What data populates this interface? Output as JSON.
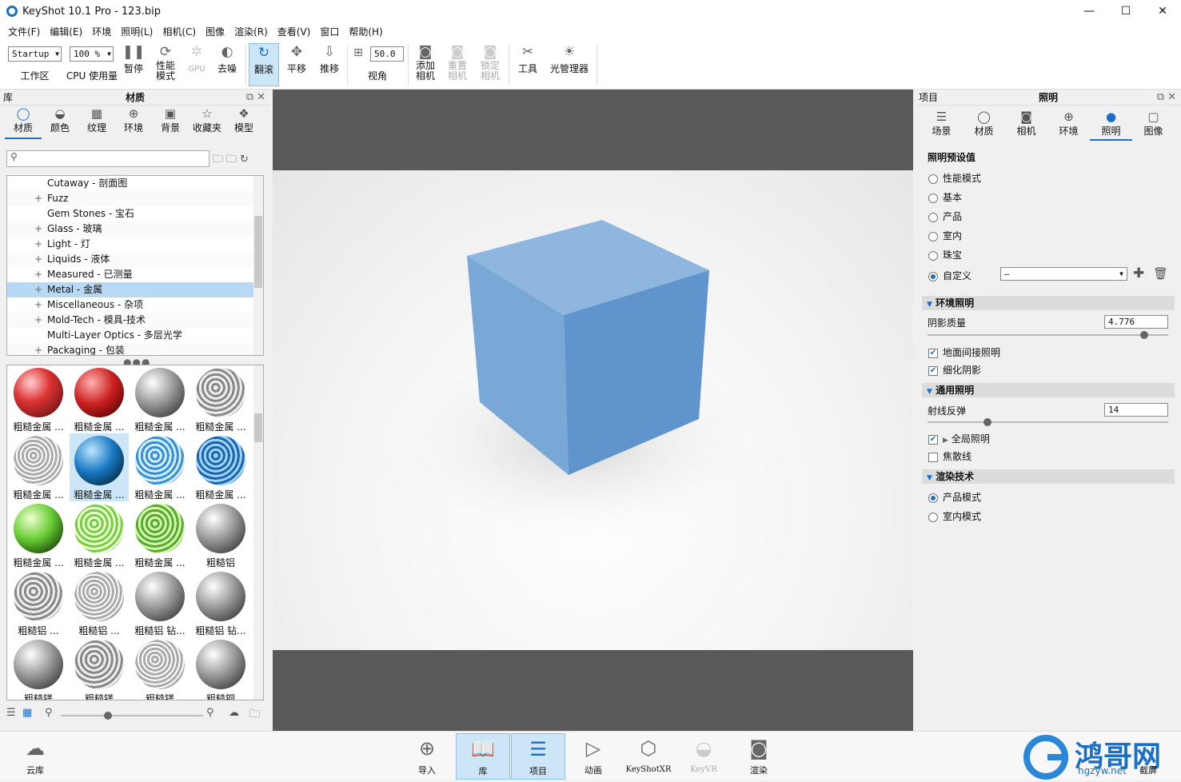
{
  "window": {
    "title": "KeyShot 10.1 Pro  - 123.bip",
    "min": "—",
    "max": "☐",
    "close": "✕"
  },
  "menu": [
    "文件(F)",
    "编辑(E)",
    "环境",
    "照明(L)",
    "相机(C)",
    "图像",
    "渲染(R)",
    "查看(V)",
    "窗口",
    "帮助(H)"
  ],
  "toolbar": {
    "workspace_value": "Startup",
    "workspace_label": "工作区",
    "cpu_value": "100 %",
    "cpu_label": "CPU 使用量",
    "pause": "暂停",
    "perf_mode": "性能\n模式",
    "gpu": "GPU",
    "denoise": "去噪",
    "tumble": "翻滚",
    "pan": "平移",
    "dolly": "推移",
    "fov_value": "50.0",
    "fov_label": "视角",
    "add_camera": "添加\n相机",
    "reset_camera": "重置\n相机",
    "lock_camera": "锁定\n相机",
    "tools": "工具",
    "light_manager": "光管理器"
  },
  "library": {
    "panel_left": "库",
    "panel_title": "材质",
    "tabs": [
      "材质",
      "颜色",
      "纹理",
      "环境",
      "背景",
      "收藏夹",
      "模型"
    ],
    "search_placeholder": "⚲",
    "tree": [
      {
        "label": "Cutaway - 剖面图",
        "pm": ""
      },
      {
        "label": "Fuzz",
        "pm": "+"
      },
      {
        "label": "Gem Stones - 宝石",
        "pm": ""
      },
      {
        "label": "Glass - 玻璃",
        "pm": "+"
      },
      {
        "label": "Light - 灯",
        "pm": "+"
      },
      {
        "label": "Liquids - 液体",
        "pm": "+"
      },
      {
        "label": "Measured - 已测量",
        "pm": "+"
      },
      {
        "label": "Metal - 金属",
        "pm": "+"
      },
      {
        "label": "Miscellaneous - 杂项",
        "pm": "+"
      },
      {
        "label": "Mold-Tech - 模具-技术",
        "pm": "+"
      },
      {
        "label": "Multi-Layer Optics - 多层光学",
        "pm": ""
      },
      {
        "label": "Packaging - 包装",
        "pm": "+"
      }
    ],
    "selected_tree_index": 7,
    "thumbs": [
      {
        "cap": "粗糙金属 ...",
        "color": "red1"
      },
      {
        "cap": "粗糙金属 ...",
        "color": "red2"
      },
      {
        "cap": "粗糙金属 ...",
        "color": "chrome"
      },
      {
        "cap": "粗糙金属 ...",
        "color": "mesh"
      },
      {
        "cap": "粗糙金属 ...",
        "color": "mesh2"
      },
      {
        "cap": "粗糙金属 ...",
        "color": "blue1"
      },
      {
        "cap": "粗糙金属 ...",
        "color": "blue2"
      },
      {
        "cap": "粗糙金属 ...",
        "color": "blue3"
      },
      {
        "cap": "粗糙金属 ...",
        "color": "green1"
      },
      {
        "cap": "粗糙金属 ...",
        "color": "green2"
      },
      {
        "cap": "粗糙金属 ...",
        "color": "green3"
      },
      {
        "cap": "粗糙铝",
        "color": "chrome"
      },
      {
        "cap": "粗糙铝 ...",
        "color": "mesh"
      },
      {
        "cap": "粗糙铝 ...",
        "color": "mesh2"
      },
      {
        "cap": "粗糙铝 钻...",
        "color": "chrome"
      },
      {
        "cap": "粗糙铝 钻...",
        "color": "chrome"
      },
      {
        "cap": "粗糙镁",
        "color": "chrome"
      },
      {
        "cap": "粗糙镁",
        "color": "mesh"
      },
      {
        "cap": "粗糙镁",
        "color": "mesh2"
      },
      {
        "cap": "粗糙铜",
        "color": "chrome"
      }
    ],
    "selected_thumb_index": 5
  },
  "project": {
    "panel_left": "项目",
    "panel_title": "照明",
    "tabs": [
      "场景",
      "材质",
      "相机",
      "环境",
      "照明",
      "图像"
    ],
    "presets_title": "照明预设值",
    "presets": [
      "性能模式",
      "基本",
      "产品",
      "室内",
      "珠宝",
      "自定义"
    ],
    "preset_selected": 5,
    "custom_value": "–",
    "env_section": "环境照明",
    "shadow_quality_label": "阴影质量",
    "shadow_quality_value": "4.776",
    "shadow_quality_level": 0.9,
    "ground_indirect": "地面间接照明",
    "refine_shadows": "细化阴影",
    "general_section": "通用照明",
    "ray_bounces_label": "射线反弹",
    "ray_bounces_value": "14",
    "ray_bounces_level": 0.25,
    "global_illumination": "全局照明",
    "caustics": "焦散线",
    "render_section": "渲染技术",
    "render_modes": [
      "产品模式",
      "室内模式"
    ]
  },
  "bottom": {
    "cloud": "云库",
    "import": "导入",
    "library": "库",
    "project": "项目",
    "animation": "动画",
    "keyshotxr": "KeyShotXR",
    "keyvr": "KeyVR",
    "render": "渲染",
    "screenshot": "截屏"
  },
  "watermark": {
    "logo": "鸿哥网",
    "url": "hgzyw.net"
  },
  "colors": {
    "accent": "#1a6fc4",
    "cube_top": "#8fb6df",
    "cube_left": "#7aa8d6",
    "cube_right": "#5f95cc"
  }
}
